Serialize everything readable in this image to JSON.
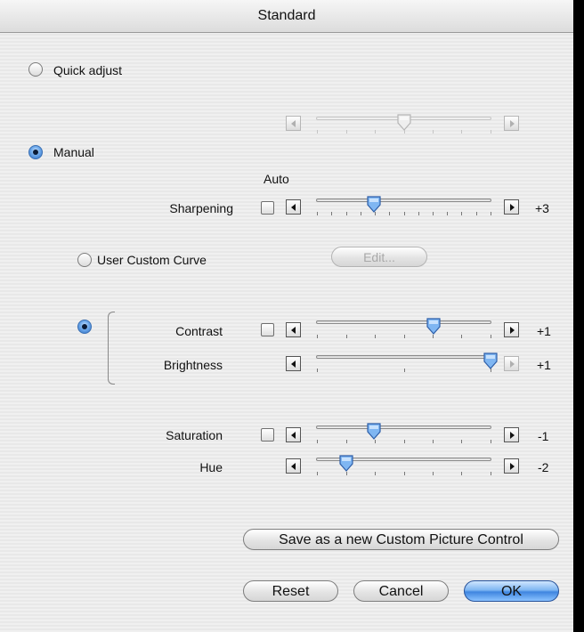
{
  "window": {
    "title": "Standard"
  },
  "mode": {
    "quick_adjust_label": "Quick adjust",
    "quick_adjust_selected": false,
    "manual_label": "Manual",
    "manual_selected": true
  },
  "quick_adjust_slider": {
    "level": 0.5,
    "enabled": false
  },
  "auto_label": "Auto",
  "sharpening": {
    "label": "Sharpening",
    "value_text": "+3",
    "level": 0.33,
    "auto_checked": false
  },
  "tone": {
    "user_custom_curve_label": "User Custom Curve",
    "user_custom_curve_selected": false,
    "edit_button_label": "Edit...",
    "manual_tone_selected": true
  },
  "contrast": {
    "label": "Contrast",
    "value_text": "+1",
    "level": 0.67,
    "auto_checked": false
  },
  "brightness": {
    "label": "Brightness",
    "value_text": "+1",
    "level": 1.0
  },
  "saturation": {
    "label": "Saturation",
    "value_text": "-1",
    "level": 0.33,
    "auto_checked": false
  },
  "hue": {
    "label": "Hue",
    "value_text": "-2",
    "level": 0.17
  },
  "buttons": {
    "save_new": "Save as a new Custom Picture Control",
    "reset": "Reset",
    "cancel": "Cancel",
    "ok": "OK"
  },
  "colors": {
    "accent": "#3f86e0",
    "window_bg": "#ececec",
    "outside_bg": "#000000"
  }
}
